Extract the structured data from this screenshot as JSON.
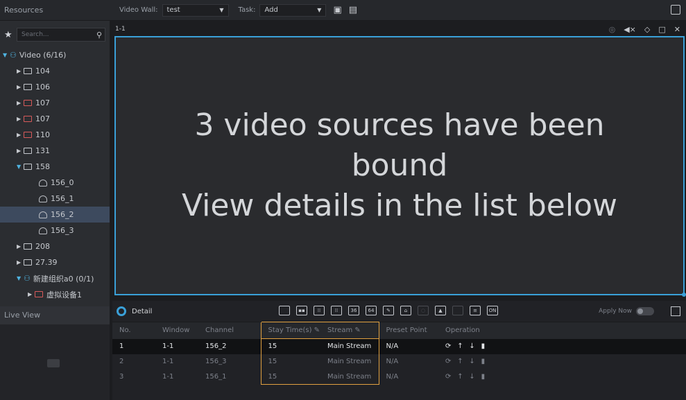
{
  "sidebar": {
    "header": "Resources",
    "search_placeholder": "Search...",
    "tree": [
      {
        "label": "Video (6/16)",
        "level": 0,
        "type": "root",
        "expanded": true
      },
      {
        "label": "104",
        "level": 1,
        "type": "device"
      },
      {
        "label": "106",
        "level": 1,
        "type": "device"
      },
      {
        "label": "107",
        "level": 1,
        "type": "device-red"
      },
      {
        "label": "107",
        "level": 1,
        "type": "device-red"
      },
      {
        "label": "110",
        "level": 1,
        "type": "device-red"
      },
      {
        "label": "131",
        "level": 1,
        "type": "device"
      },
      {
        "label": "158",
        "level": 1,
        "type": "device",
        "expanded": true
      },
      {
        "label": "156_0",
        "level": 2,
        "type": "camera"
      },
      {
        "label": "156_1",
        "level": 2,
        "type": "camera"
      },
      {
        "label": "156_2",
        "level": 2,
        "type": "camera",
        "selected": true
      },
      {
        "label": "156_3",
        "level": 2,
        "type": "camera"
      },
      {
        "label": "208",
        "level": 1,
        "type": "device"
      },
      {
        "label": "27.39",
        "level": 1,
        "type": "device"
      },
      {
        "label": "新建组织a0 (0/1)",
        "level": 1,
        "type": "org",
        "expanded": true
      },
      {
        "label": "虚拟设备1",
        "level": 2,
        "type": "device-red"
      }
    ],
    "live_view": "Live View"
  },
  "toolbar": {
    "video_wall_label": "Video Wall:",
    "video_wall_value": "test",
    "task_label": "Task:",
    "task_value": "Add"
  },
  "pane": {
    "id": "1-1",
    "message_line1": "3 video sources have been",
    "message_line2": "bound",
    "message_line3": "View details in the list below"
  },
  "detail": {
    "title": "Detail",
    "layout_labels": [
      "",
      "",
      "",
      "",
      "36",
      "64"
    ],
    "apply_now": "Apply Now",
    "columns": [
      "No.",
      "Window",
      "Channel",
      "Stay Time(s)",
      "Stream",
      "Preset Point",
      "Operation"
    ],
    "rows": [
      {
        "no": "1",
        "window": "1-1",
        "channel": "156_2",
        "stay": "15",
        "stream": "Main Stream",
        "preset": "N/A"
      },
      {
        "no": "2",
        "window": "1-1",
        "channel": "156_3",
        "stay": "15",
        "stream": "Main Stream",
        "preset": "N/A"
      },
      {
        "no": "3",
        "window": "1-1",
        "channel": "156_1",
        "stay": "15",
        "stream": "Main Stream",
        "preset": "N/A"
      }
    ]
  },
  "colors": {
    "accent": "#3aa0d8",
    "highlight": "#e0a040"
  }
}
